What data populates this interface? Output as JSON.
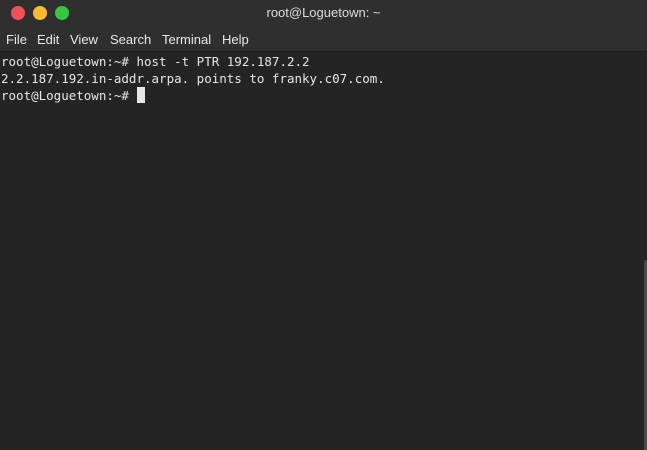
{
  "window": {
    "title": "root@Loguetown: ~"
  },
  "menu": {
    "items": [
      "File",
      "Edit",
      "View",
      "Search",
      "Terminal",
      "Help"
    ]
  },
  "terminal": {
    "prompt": "root@Loguetown:~#",
    "command": "host -t PTR 192.187.2.2",
    "output": "2.2.187.192.in-addr.arpa. points to franky.c07.com."
  },
  "colors": {
    "close": "#f25056",
    "minimize": "#fbb92c",
    "maximize": "#36c63f",
    "background": "#242424",
    "chrome": "#2f2f2f",
    "text": "#e6e6e6"
  },
  "icons": [
    "close-icon",
    "minimize-icon",
    "maximize-icon"
  ]
}
